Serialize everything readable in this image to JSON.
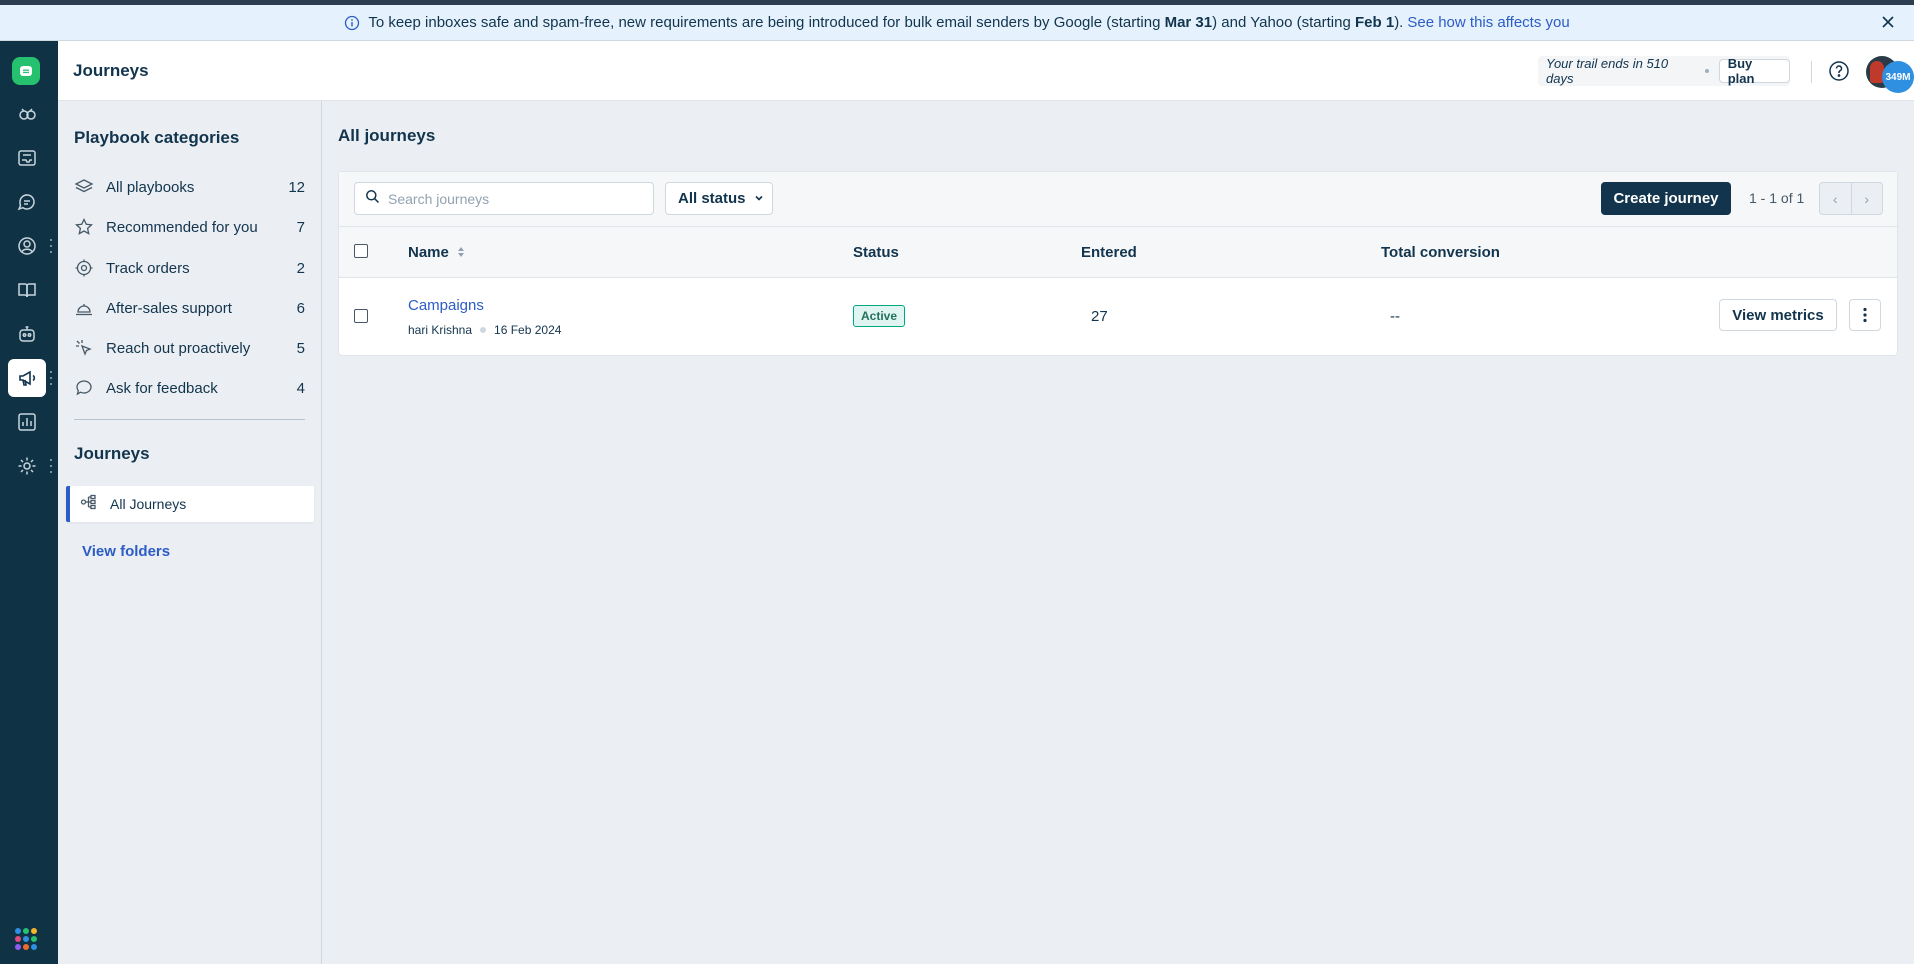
{
  "banner": {
    "text_1": "To keep inboxes safe and spam-free, new requirements are being introduced for bulk email senders by Google (starting",
    "bold_1": "Mar 31",
    "text_2": ") and Yahoo (starting",
    "bold_2": "Feb 1",
    "text_3": ").",
    "link": "See how this affects you"
  },
  "header": {
    "title": "Journeys",
    "trail_text": "Your trail ends in 510 days",
    "buy_plan": "Buy plan",
    "avatar_badge": "349M"
  },
  "sidebar": {
    "categories_heading": "Playbook categories",
    "categories": [
      {
        "label": "All playbooks",
        "count": "12",
        "icon": "layers-icon"
      },
      {
        "label": "Recommended for you",
        "count": "7",
        "icon": "star-icon"
      },
      {
        "label": "Track orders",
        "count": "2",
        "icon": "target-icon"
      },
      {
        "label": "After-sales support",
        "count": "6",
        "icon": "service-bell-icon"
      },
      {
        "label": "Reach out proactively",
        "count": "5",
        "icon": "cursor-click-icon"
      },
      {
        "label": "Ask for feedback",
        "count": "4",
        "icon": "chat-bubble-icon"
      }
    ],
    "journeys_heading": "Journeys",
    "all_journeys": "All Journeys",
    "view_folders": "View folders"
  },
  "main": {
    "title": "All journeys",
    "search_placeholder": "Search journeys",
    "status_filter": "All status",
    "create_button": "Create journey",
    "pagination": "1 - 1 of 1",
    "columns": {
      "name": "Name",
      "status": "Status",
      "entered": "Entered",
      "total_conversion": "Total conversion"
    },
    "rows": [
      {
        "name": "Campaigns",
        "author": "hari Krishna",
        "date": "16 Feb 2024",
        "status": "Active",
        "entered": "27",
        "total_conversion": "--",
        "action": "View metrics"
      }
    ]
  },
  "colors": {
    "rail_bg": "#0f3344",
    "primary_button": "#12344d",
    "link": "#2c5cc5",
    "active_badge_bg": "#e0f5f1",
    "active_badge_border": "#00a886",
    "brand_green": "#25c16f"
  }
}
